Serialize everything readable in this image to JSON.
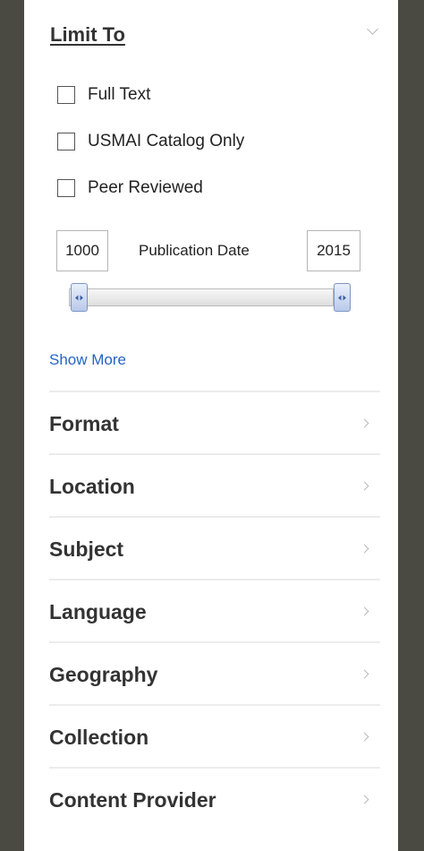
{
  "limit_to": {
    "title": "Limit To",
    "checkboxes": [
      {
        "label": "Full Text",
        "checked": false
      },
      {
        "label": "USMAI Catalog Only",
        "checked": false
      },
      {
        "label": "Peer Reviewed",
        "checked": false
      }
    ],
    "date": {
      "label": "Publication Date",
      "from": "1000",
      "to": "2015"
    },
    "show_more": "Show More"
  },
  "facets": [
    {
      "label": "Format"
    },
    {
      "label": "Location"
    },
    {
      "label": "Subject"
    },
    {
      "label": "Language"
    },
    {
      "label": "Geography"
    },
    {
      "label": "Collection"
    },
    {
      "label": "Content Provider"
    }
  ],
  "colors": {
    "background": "#4a4a42",
    "panel": "#ffffff",
    "link": "#2464c4",
    "handle": "#b9c9ea"
  }
}
